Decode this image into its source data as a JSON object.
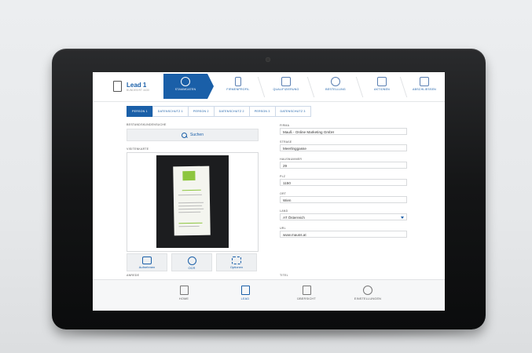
{
  "header": {
    "lead_title": "Lead 1",
    "lead_sub": "BUNDESIRT 4430",
    "steps": [
      {
        "label": "STAMMDATEN",
        "icon": "id-icon"
      },
      {
        "label": "FIRMENPROFIL",
        "icon": "profile-icon"
      },
      {
        "label": "QUALIFIZIERUNG",
        "icon": "list-icon"
      },
      {
        "label": "BESTELLUNG",
        "icon": "order-icon"
      },
      {
        "label": "AKTIONEN",
        "icon": "edit-icon"
      },
      {
        "label": "ABSCHLIESSEN",
        "icon": "finish-icon"
      }
    ]
  },
  "subtabs": [
    "PERSON 1",
    "DATENSCHUTZ 1",
    "PERSON 2",
    "DATENSCHUTZ 2",
    "PERSON 3",
    "DATENSCHUTZ 3"
  ],
  "left": {
    "bestand_label": "BESTANDSKUNDENSUCHE",
    "search_label": "Suchen",
    "visitenkarte_label": "VISITENKARTE",
    "actions": [
      {
        "label": "Aufnehmen",
        "icon": "camera-icon"
      },
      {
        "label": "OCR",
        "icon": "info-icon"
      },
      {
        "label": "Optionen",
        "icon": "options-icon"
      }
    ],
    "anrede_label": "ANREDE"
  },
  "right": {
    "fields": [
      {
        "label": "FIRMA",
        "value": "Mauß - Online Marketing GmbH"
      },
      {
        "label": "STRAßE",
        "value": "Meerlinggasse"
      },
      {
        "label": "HAUSNUMMER",
        "value": "29"
      },
      {
        "label": "PLZ",
        "value": "1150"
      },
      {
        "label": "ORT",
        "value": "Wien"
      },
      {
        "label": "LAND",
        "value": "AT Österreich"
      },
      {
        "label": "URL",
        "value": "www.mauss.at"
      }
    ],
    "titel_label": "TITEL"
  },
  "nav": [
    {
      "label": "HOME",
      "icon": "home-icon"
    },
    {
      "label": "LEAD",
      "icon": "lead-icon"
    },
    {
      "label": "ÜBERSICHT",
      "icon": "overview-icon"
    },
    {
      "label": "EINSTELLUNGEN",
      "icon": "settings-icon"
    }
  ],
  "colors": {
    "accent": "#1a5fa8",
    "card_green": "#8dc63f"
  }
}
